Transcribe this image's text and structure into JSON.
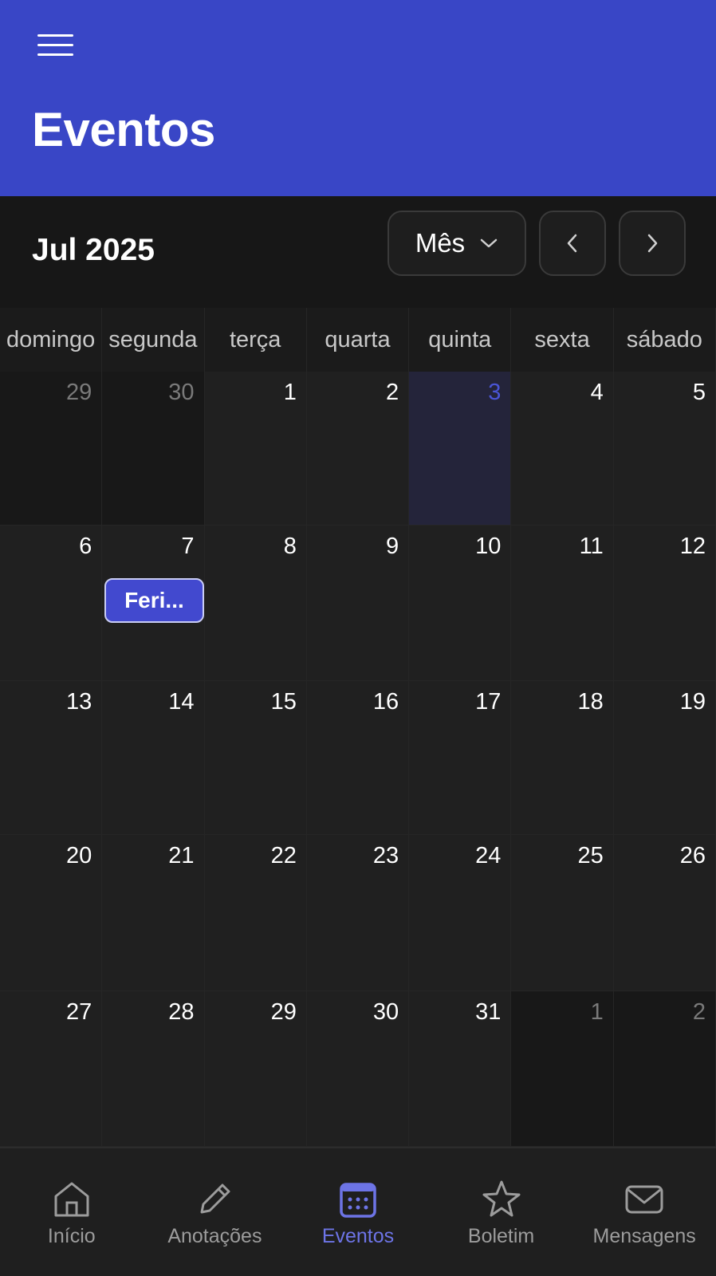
{
  "header": {
    "title": "Eventos",
    "menu_icon": "hamburger-menu-icon",
    "bg_color": "#3946c6"
  },
  "toolbar": {
    "month_label": "Jul 2025",
    "view_select": {
      "selected": "Mês"
    },
    "prev_icon": "chevron-left-icon",
    "next_icon": "chevron-right-icon"
  },
  "calendar": {
    "weekdays": [
      "domingo",
      "segunda",
      "terça",
      "quarta",
      "quinta",
      "sexta",
      "sábado"
    ],
    "weeks": [
      [
        {
          "day": "29",
          "outside": true
        },
        {
          "day": "30",
          "outside": true
        },
        {
          "day": "1"
        },
        {
          "day": "2"
        },
        {
          "day": "3",
          "today": true
        },
        {
          "day": "4"
        },
        {
          "day": "5"
        }
      ],
      [
        {
          "day": "6"
        },
        {
          "day": "7",
          "event": "Feri..."
        },
        {
          "day": "8"
        },
        {
          "day": "9"
        },
        {
          "day": "10"
        },
        {
          "day": "11"
        },
        {
          "day": "12"
        }
      ],
      [
        {
          "day": "13"
        },
        {
          "day": "14"
        },
        {
          "day": "15"
        },
        {
          "day": "16"
        },
        {
          "day": "17"
        },
        {
          "day": "18"
        },
        {
          "day": "19"
        }
      ],
      [
        {
          "day": "20"
        },
        {
          "day": "21"
        },
        {
          "day": "22"
        },
        {
          "day": "23"
        },
        {
          "day": "24"
        },
        {
          "day": "25"
        },
        {
          "day": "26"
        }
      ],
      [
        {
          "day": "27"
        },
        {
          "day": "28"
        },
        {
          "day": "29"
        },
        {
          "day": "30"
        },
        {
          "day": "31"
        },
        {
          "day": "1",
          "outside": true
        },
        {
          "day": "2",
          "outside": true
        }
      ]
    ],
    "today_color": "#4a55d6",
    "event_color": "#4249cf"
  },
  "bottom_nav": {
    "items": [
      {
        "label": "Início",
        "icon": "home-icon"
      },
      {
        "label": "Anotações",
        "icon": "pencil-icon"
      },
      {
        "label": "Eventos",
        "icon": "calendar-icon",
        "active": true
      },
      {
        "label": "Boletim",
        "icon": "star-icon"
      },
      {
        "label": "Mensagens",
        "icon": "mail-icon"
      }
    ],
    "active_color": "#6d74e6"
  }
}
